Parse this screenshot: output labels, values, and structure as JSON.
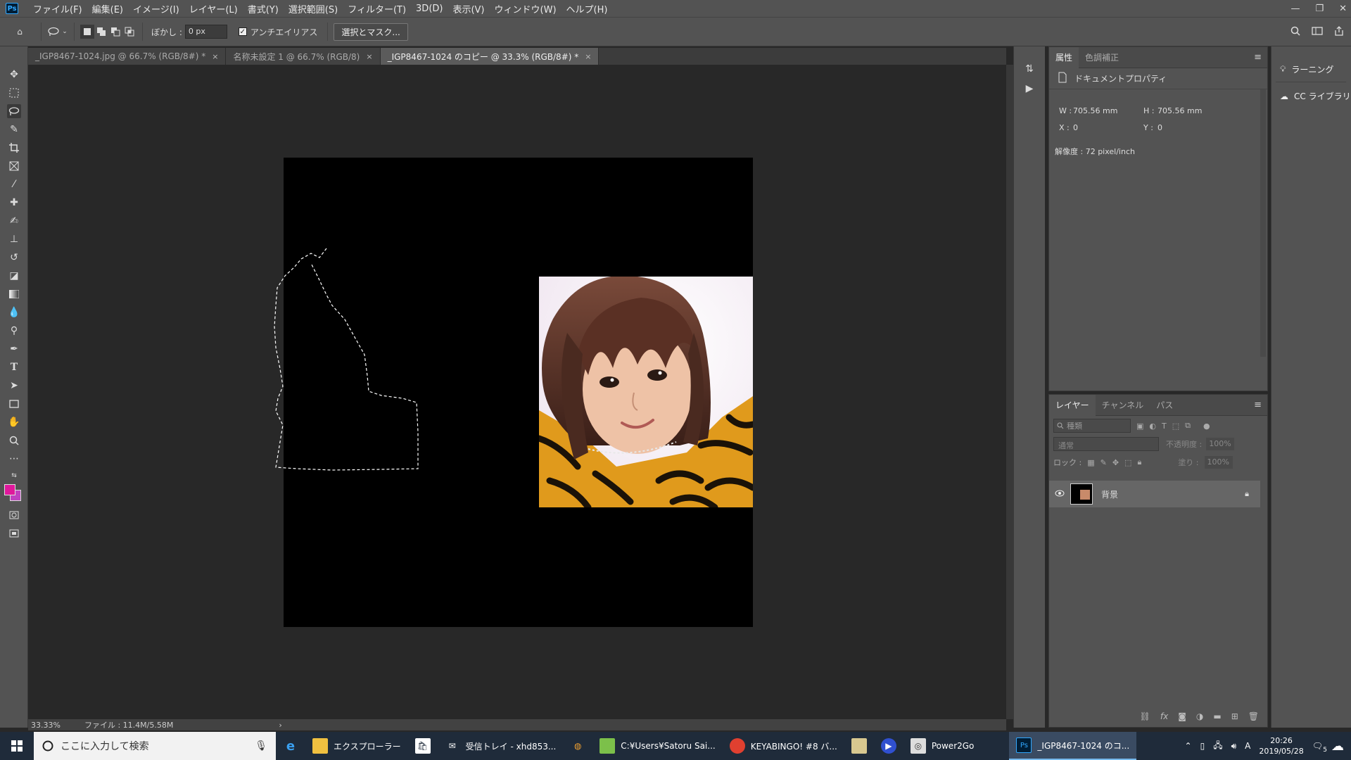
{
  "app": {
    "name": "Ps"
  },
  "menu": [
    "ファイル(F)",
    "編集(E)",
    "イメージ(I)",
    "レイヤー(L)",
    "書式(Y)",
    "選択範囲(S)",
    "フィルター(T)",
    "3D(D)",
    "表示(V)",
    "ウィンドウ(W)",
    "ヘルプ(H)"
  ],
  "window_controls": [
    "—",
    "❐",
    "✕"
  ],
  "options": {
    "feather_label": "ぼかし :",
    "feather_value": "0 px",
    "antialias_label": "アンチエイリアス",
    "select_mask_button": "選択とマスク..."
  },
  "tabs": [
    {
      "label": "_IGP8467-1024.jpg @ 66.7% (RGB/8#) *",
      "close": "×"
    },
    {
      "label": "名称未設定 1 @ 66.7% (RGB/8)",
      "close": "×"
    },
    {
      "label": "_IGP8467-1024 のコピー @ 33.3% (RGB/8#) *",
      "close": "×"
    }
  ],
  "status": {
    "zoom": "33.33%",
    "file": "ファイル : 11.4M/5.58M",
    "arrow": "›"
  },
  "properties": {
    "tabs": [
      "属性",
      "色調補正"
    ],
    "section": "ドキュメントプロパティ",
    "w_label": "W :",
    "w_value": "705.56 mm",
    "h_label": "H :",
    "h_value": "705.56 mm",
    "x_label": "X :",
    "x_value": "0",
    "y_label": "Y :",
    "y_value": "0",
    "resolution": "解像度 : 72 pixel/inch"
  },
  "learn": {
    "learn_label": "ラーニング",
    "cc_label": "CC ライブラリ"
  },
  "layers": {
    "tabs": [
      "レイヤー",
      "チャンネル",
      "パス"
    ],
    "filter_placeholder": "種類",
    "blend_mode": "通常",
    "opacity_label": "不透明度 :",
    "opacity_value": "100%",
    "lock_label": "ロック :",
    "fill_label": "塗り :",
    "fill_value": "100%",
    "items": [
      {
        "name": "背景"
      }
    ],
    "bottom_icons": [
      "link-icon",
      "fx-icon",
      "mask-icon",
      "adjustment-icon",
      "folder-icon",
      "new-layer-icon",
      "trash-icon"
    ]
  },
  "colors": {
    "foreground": "#e0189c",
    "background": "#c040c0",
    "accent": "#31a8ff"
  },
  "taskbar": {
    "search_placeholder": "ここに入力して検索",
    "items": [
      {
        "label": "",
        "icon": "edge-icon"
      },
      {
        "label": "エクスプローラー",
        "icon": "folder-icon"
      },
      {
        "label": "",
        "icon": "store-icon"
      },
      {
        "label": "受信トレイ - xhd853...",
        "icon": "mail-icon"
      },
      {
        "label": "",
        "icon": "app-icon"
      },
      {
        "label": "C:¥Users¥Satoru Sai...",
        "icon": "notepad-icon"
      },
      {
        "label": "KEYABINGO! #8 バ...",
        "icon": "chrome-icon"
      },
      {
        "label": "",
        "icon": "folder-icon"
      },
      {
        "label": "",
        "icon": "media-icon"
      },
      {
        "label": "Power2Go",
        "icon": "disc-icon"
      },
      {
        "label": "_IGP8467-1024 のコ...",
        "icon": "ps-icon"
      }
    ],
    "tray_ime": "A",
    "time": "20:26",
    "date": "2019/05/28",
    "notif_count": "5"
  }
}
